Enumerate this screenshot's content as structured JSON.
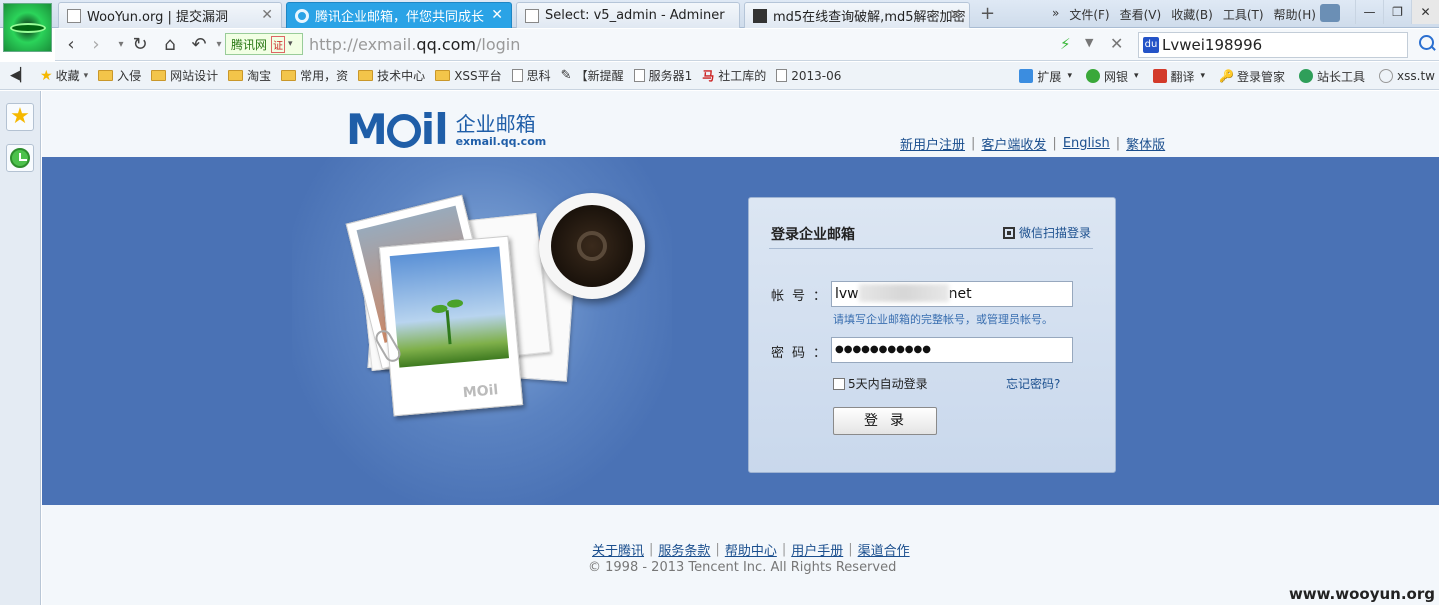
{
  "browser": {
    "tabs": [
      {
        "title": "WooYun.org | 提交漏洞",
        "active": false
      },
      {
        "title": "腾讯企业邮箱，伴您共同成长",
        "active": true
      },
      {
        "title": "Select: v5_admin - Adminer",
        "active": false
      },
      {
        "title": "md5在线查询破解,md5解密加密",
        "active": false
      }
    ],
    "menu": [
      "»",
      "文件(F)",
      "查看(V)",
      "收藏(B)",
      "工具(T)",
      "帮助(H)"
    ],
    "cert_label": "腾讯网",
    "cert_badge": "证",
    "url_prefix": "http://exmail.",
    "url_domain": "qq.com",
    "url_path": "/login",
    "search_value": "Lvwei198996"
  },
  "bookmarks": {
    "favorites": "收藏",
    "items": [
      {
        "label": "入侵",
        "icon": "folder"
      },
      {
        "label": "网站设计",
        "icon": "folder"
      },
      {
        "label": "淘宝",
        "icon": "folder"
      },
      {
        "label": "常用，资",
        "icon": "folder"
      },
      {
        "label": "技术中心",
        "icon": "folder"
      },
      {
        "label": "XSS平台",
        "icon": "folder"
      },
      {
        "label": "思科",
        "icon": "page"
      },
      {
        "label": "【新提醒",
        "icon": "tool"
      },
      {
        "label": "服务器1",
        "icon": "page"
      },
      {
        "label": "社工库的",
        "icon": "horse"
      },
      {
        "label": "2013-06",
        "icon": "page"
      }
    ],
    "right": [
      {
        "label": "扩展",
        "color": "#3b8de0"
      },
      {
        "label": "网银",
        "color": "#3aa83a"
      },
      {
        "label": "翻译",
        "color": "#d33a2a"
      },
      {
        "label": "登录管家",
        "color": "#2a6fd0"
      },
      {
        "label": "站长工具",
        "color": "#2f9f5a"
      },
      {
        "label": "xss.tw",
        "color": "#999999"
      }
    ]
  },
  "site": {
    "brand_cn": "企业邮箱",
    "brand_domain": "exmail.qq.com",
    "top_links": [
      "新用户注册",
      "客户端收发",
      "English",
      "繁体版"
    ],
    "illustration_mark": "MOil"
  },
  "login": {
    "title": "登录企业邮箱",
    "qr_label": "微信扫描登录",
    "account_label": "帐号：",
    "account_prefix": "lvw",
    "account_suffix": "net",
    "account_hint": "请填写企业邮箱的完整帐号，或管理员帐号。",
    "password_label": "密码：",
    "password_mask": "●●●●●●●●●●●",
    "remember_label": "5天内自动登录",
    "forgot_label": "忘记密码?",
    "submit_label": "登录"
  },
  "footer": {
    "links": [
      "关于腾讯",
      "服务条款",
      "帮助中心",
      "用户手册",
      "渠道合作"
    ],
    "copyright": "© 1998 - 2013 Tencent Inc. All Rights Reserved",
    "watermark": "www.wooyun.org"
  }
}
